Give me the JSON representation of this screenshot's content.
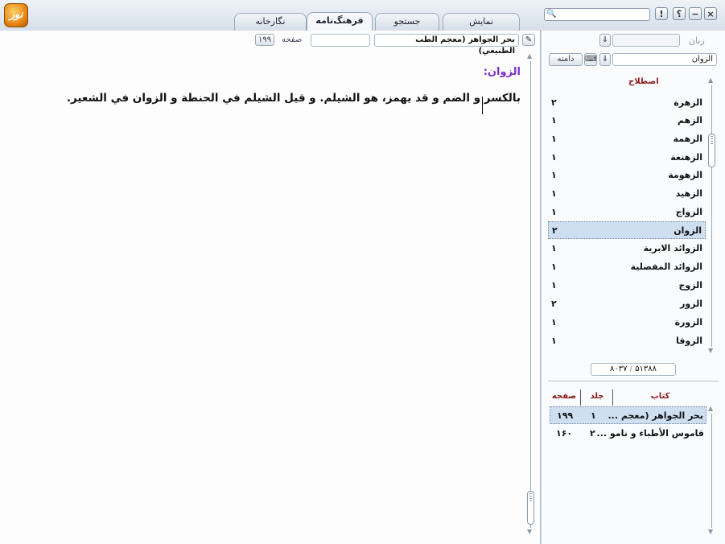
{
  "tabs": [
    {
      "label": "نگارخانه",
      "active": false
    },
    {
      "label": "فرهنگ‌نامه",
      "active": true
    },
    {
      "label": "جستجو",
      "active": false
    },
    {
      "label": "نمایش",
      "active": false
    }
  ],
  "window_buttons": {
    "close": "×",
    "minimize": "−",
    "help": "؟",
    "info": "!"
  },
  "search": {
    "value": "",
    "placeholder": ""
  },
  "toolbar": {
    "source_label": "بحر الجواهر (معجم الطب الطبيعي)",
    "page_value": "",
    "page_label": "صفحه",
    "page_number": "۱۹۹"
  },
  "content": {
    "term_title": "الزوان:",
    "body": "بالكسر و الضم و قد يهمز، هو الشيلم. و قيل الشيلم في الحنطة و الزوان في الشعير."
  },
  "sidebar": {
    "language_label": "زبان",
    "language_value": "",
    "term_input_value": "الزوان",
    "scope_button": "دامنه",
    "list_header": "اصطلاح",
    "terms": [
      {
        "name": "الزهرة",
        "count": "۲",
        "selected": false
      },
      {
        "name": "الزهم",
        "count": "۱",
        "selected": false
      },
      {
        "name": "الزهمة",
        "count": "۱",
        "selected": false
      },
      {
        "name": "الزهنعة",
        "count": "۱",
        "selected": false
      },
      {
        "name": "الزهومة",
        "count": "۱",
        "selected": false
      },
      {
        "name": "الزهيد",
        "count": "۱",
        "selected": false
      },
      {
        "name": "الزواج",
        "count": "۱",
        "selected": false
      },
      {
        "name": "الزوان",
        "count": "۲",
        "selected": true
      },
      {
        "name": "الزوائد الابرية",
        "count": "۱",
        "selected": false
      },
      {
        "name": "الزوائد المفصلية",
        "count": "۱",
        "selected": false
      },
      {
        "name": "الزوج",
        "count": "۱",
        "selected": false
      },
      {
        "name": "الزور",
        "count": "۲",
        "selected": false
      },
      {
        "name": "الزورة",
        "count": "۱",
        "selected": false
      },
      {
        "name": "الزوفا",
        "count": "۱",
        "selected": false
      }
    ],
    "counter_total": "۵۱۳۸۸",
    "counter_current": "۸۰۳۷",
    "books_header": {
      "book": "کتاب",
      "volume": "جلد",
      "page": "صفحه"
    },
    "books": [
      {
        "book": "بحر الجواهر (معجم ...",
        "volume": "۱",
        "page": "۱۹۹",
        "selected": true
      },
      {
        "book": "قاموس الأطباء و نامو ...",
        "volume": "۲",
        "page": "۱۶۰",
        "selected": false
      }
    ]
  },
  "colors": {
    "accent": "#7a2fc6",
    "header_red": "#8b1a1a",
    "selection": "#cfdff2"
  }
}
